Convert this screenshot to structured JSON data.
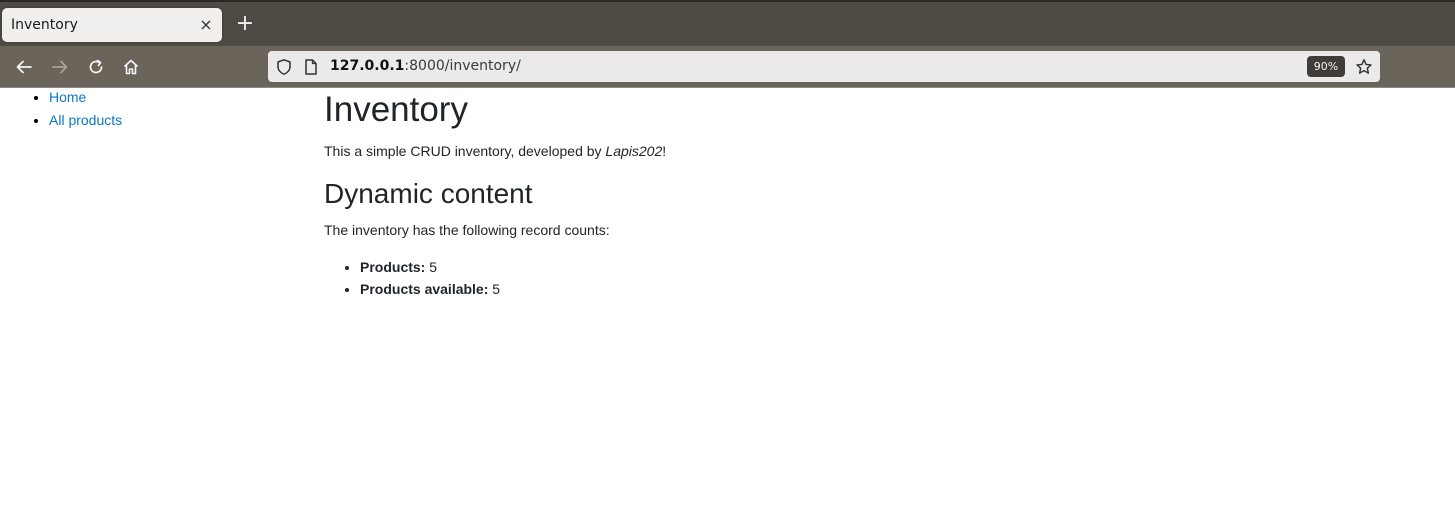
{
  "browser": {
    "tab_title": "Inventory",
    "tab_close": "×",
    "new_tab": "+",
    "url_host": "127.0.0.1",
    "url_rest": ":8000/inventory/",
    "zoom": "90%"
  },
  "sidebar": {
    "links": [
      {
        "label": "Home"
      },
      {
        "label": "All products"
      }
    ]
  },
  "main": {
    "title": "Inventory",
    "intro_before": "This a simple CRUD inventory, developed by ",
    "intro_author": "Lapis202",
    "intro_after": "!",
    "section_title": "Dynamic content",
    "counts_intro": "The inventory has the following record counts:",
    "counts": [
      {
        "label": "Products:",
        "value": "5"
      },
      {
        "label": "Products available:",
        "value": "5"
      }
    ]
  },
  "colors": {
    "link": "#0b78c6",
    "tabbar": "#4f4a44",
    "navbar": "#6a645b"
  }
}
